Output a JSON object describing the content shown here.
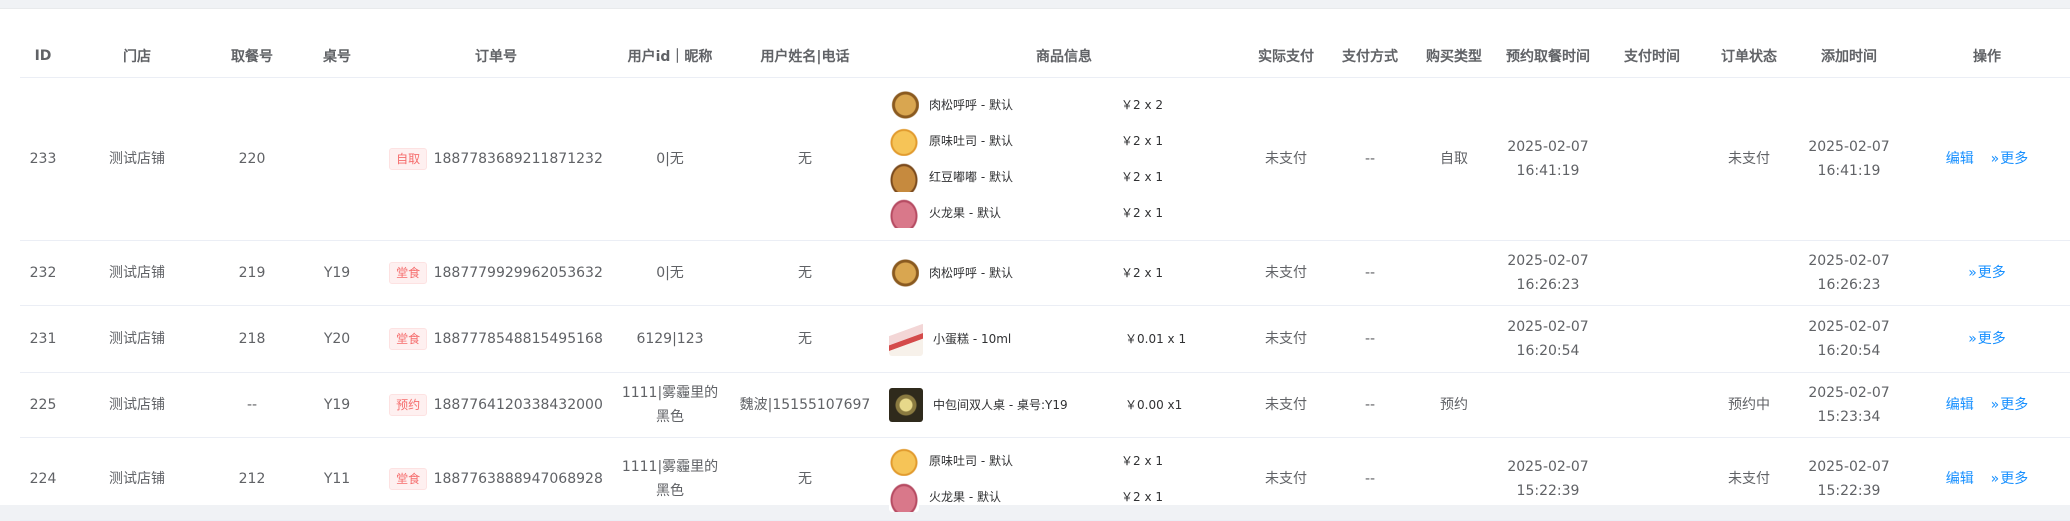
{
  "columns": [
    "ID",
    "门店",
    "取餐号",
    "桌号",
    "订单号",
    "用户id｜昵称",
    "用户姓名|电话",
    "商品信息",
    "实际支付",
    "支付方式",
    "购买类型",
    "预约取餐时间",
    "支付时间",
    "订单状态",
    "添加时间",
    "操作"
  ],
  "actions": {
    "edit": "编辑",
    "more": "更多"
  },
  "colors": {
    "link": "#1890ff",
    "tag_text": "#f56c6c",
    "tag_bg": "#fef0f0"
  },
  "rows": [
    {
      "id": "233",
      "store": "测试店铺",
      "pickup_no": "220",
      "table_no": "",
      "order_tag": "自取",
      "order_no": "1887783689211871232",
      "user": "0|无",
      "name_phone": "无",
      "goods": [
        {
          "icon": "meat-floss-bun-thumbnail",
          "name": "肉松呼呼 - 默认",
          "price": "￥2 x 2"
        },
        {
          "icon": "plain-toast-thumbnail",
          "name": "原味吐司 - 默认",
          "price": "￥2 x 1"
        },
        {
          "icon": "red-bean-bun-thumbnail",
          "name": "红豆嘟嘟 - 默认",
          "price": "￥2 x 1"
        },
        {
          "icon": "dragon-fruit-thumbnail",
          "name": "火龙果 - 默认",
          "price": "￥2 x 1"
        }
      ],
      "paid": "未支付",
      "pay_method": "--",
      "buy_type": "自取",
      "reserve_date": "2025-02-07",
      "reserve_time": "16:41:19",
      "pay_time": "",
      "status": "未支付",
      "add_date": "2025-02-07",
      "add_time": "16:41:19"
    },
    {
      "id": "232",
      "store": "测试店铺",
      "pickup_no": "219",
      "table_no": "Y19",
      "order_tag": "堂食",
      "order_no": "1887779929962053632",
      "user": "0|无",
      "name_phone": "无",
      "goods": [
        {
          "icon": "meat-floss-bun-thumbnail",
          "name": "肉松呼呼 - 默认",
          "price": "￥2 x 1"
        }
      ],
      "paid": "未支付",
      "pay_method": "--",
      "buy_type": "",
      "reserve_date": "2025-02-07",
      "reserve_time": "16:26:23",
      "pay_time": "",
      "status": "",
      "add_date": "2025-02-07",
      "add_time": "16:26:23"
    },
    {
      "id": "231",
      "store": "测试店铺",
      "pickup_no": "218",
      "table_no": "Y20",
      "order_tag": "堂食",
      "order_no": "1887778548815495168",
      "user": "6129|123",
      "name_phone": "无",
      "goods": [
        {
          "icon": "small-cake-thumbnail",
          "name": "小蛋糕 - 10ml",
          "price": "￥0.01 x 1"
        }
      ],
      "paid": "未支付",
      "pay_method": "--",
      "buy_type": "",
      "reserve_date": "2025-02-07",
      "reserve_time": "16:20:54",
      "pay_time": "",
      "status": "",
      "add_date": "2025-02-07",
      "add_time": "16:20:54"
    },
    {
      "id": "225",
      "store": "测试店铺",
      "pickup_no": "--",
      "table_no": "Y19",
      "order_tag": "预约",
      "order_no": "1887764120338432000",
      "user_line1": "1111|雾霾里的",
      "user_line2": "黑色",
      "name_phone": "魏波|15155107697",
      "goods": [
        {
          "icon": "private-room-thumbnail",
          "name": "中包间双人桌 - 桌号:Y19",
          "price": "￥0.00 x1"
        }
      ],
      "paid": "未支付",
      "pay_method": "--",
      "buy_type": "预约",
      "reserve_date": "",
      "reserve_time": "",
      "pay_time": "",
      "status": "预约中",
      "add_date": "2025-02-07",
      "add_time": "15:23:34"
    },
    {
      "id": "224",
      "store": "测试店铺",
      "pickup_no": "212",
      "table_no": "Y11",
      "order_tag": "堂食",
      "order_no": "1887763888947068928",
      "user_line1": "1111|雾霾里的",
      "user_line2": "黑色",
      "name_phone": "无",
      "goods": [
        {
          "icon": "plain-toast-thumbnail",
          "name": "原味吐司 - 默认",
          "price": "￥2 x 1"
        },
        {
          "icon": "dragon-fruit-thumbnail",
          "name": "火龙果 - 默认",
          "price": "￥2 x 1"
        }
      ],
      "paid": "未支付",
      "pay_method": "--",
      "buy_type": "",
      "reserve_date": "2025-02-07",
      "reserve_time": "15:22:39",
      "pay_time": "",
      "status": "未支付",
      "add_date": "2025-02-07",
      "add_time": "15:22:39"
    }
  ]
}
